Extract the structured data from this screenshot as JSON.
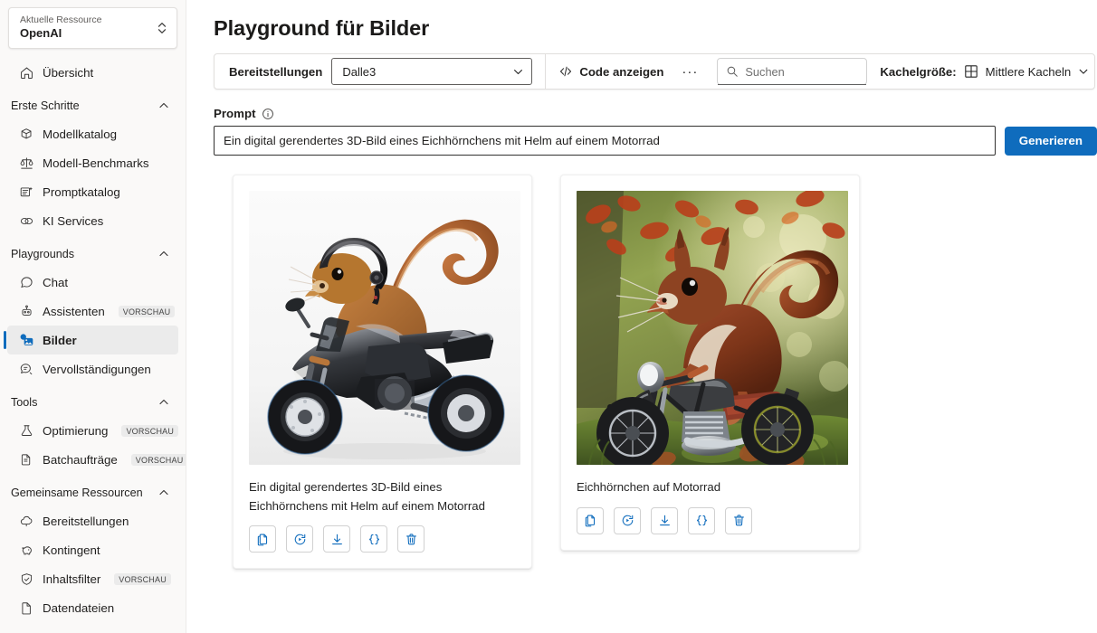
{
  "sidebar": {
    "resource": {
      "label": "Aktuelle Ressource",
      "value": "OpenAI"
    },
    "overview": {
      "label": "Übersicht",
      "icon": "home-icon"
    },
    "groups": [
      {
        "title": "Erste Schritte",
        "items": [
          {
            "label": "Modellkatalog",
            "icon": "cube-icon",
            "badge": ""
          },
          {
            "label": "Modell-Benchmarks",
            "icon": "scales-icon",
            "badge": ""
          },
          {
            "label": "Promptkatalog",
            "icon": "prompt-doc-icon",
            "badge": ""
          },
          {
            "label": "KI Services",
            "icon": "link-chain-icon",
            "badge": ""
          }
        ]
      },
      {
        "title": "Playgrounds",
        "items": [
          {
            "label": "Chat",
            "icon": "chat-bubble-icon",
            "badge": ""
          },
          {
            "label": "Assistenten",
            "icon": "robot-icon",
            "badge": "VORSCHAU"
          },
          {
            "label": "Bilder",
            "icon": "image-icon",
            "badge": "",
            "selected": true
          },
          {
            "label": "Vervollständigungen",
            "icon": "completions-icon",
            "badge": ""
          }
        ]
      },
      {
        "title": "Tools",
        "items": [
          {
            "label": "Optimierung",
            "icon": "flask-icon",
            "badge": "VORSCHAU"
          },
          {
            "label": "Batchaufträge",
            "icon": "batch-doc-icon",
            "badge": "VORSCHAU"
          }
        ]
      },
      {
        "title": "Gemeinsame Ressourcen",
        "items": [
          {
            "label": "Bereitstellungen",
            "icon": "cloud-icon",
            "badge": ""
          },
          {
            "label": "Kontingent",
            "icon": "piggy-bank-icon",
            "badge": ""
          },
          {
            "label": "Inhaltsfilter",
            "icon": "shield-check-icon",
            "badge": "VORSCHAU"
          },
          {
            "label": "Datendateien",
            "icon": "file-icon",
            "badge": ""
          }
        ]
      }
    ]
  },
  "main": {
    "page_title": "Playground für Bilder",
    "toolbar": {
      "deployments_label": "Bereitstellungen",
      "deployment_value": "Dalle3",
      "view_code_label": "Code anzeigen",
      "more_label": "···",
      "search_placeholder": "Suchen",
      "search_value": "",
      "tile_size_label": "Kachelgröße:",
      "tile_size_value": "Mittlere Kacheln"
    },
    "prompt": {
      "label": "Prompt",
      "value": "Ein digital gerendertes 3D-Bild eines Eichhörnchens mit Helm auf einem Motorrad",
      "placeholder": "",
      "generate_label": "Generieren"
    },
    "action_labels": {
      "copy": "Kopieren",
      "regenerate": "Neu generieren",
      "download": "Herunterladen",
      "json": "JSON anzeigen",
      "delete": "Löschen"
    },
    "cards": [
      {
        "caption": "Ein digital gerendertes 3D-Bild eines Eichhörnchens mit Helm auf einem Motorrad",
        "image_alt": "3D-gerendertes Eichhörnchen mit schwarzem Helm auf einem schwarzen Sportmotorrad vor weißem Hintergrund"
      },
      {
        "caption": "Eichhörnchen auf Motorrad",
        "image_alt": "Fotorealistisches rotes Eichhörnchen auf einem Oldtimer-Motorrad in einem herbstlichen Wald"
      }
    ]
  },
  "colors": {
    "accent": "#0f6cbd",
    "sidebar_bg": "#faf9f8",
    "selected_bg": "#ebebeb",
    "text": "#242424"
  }
}
